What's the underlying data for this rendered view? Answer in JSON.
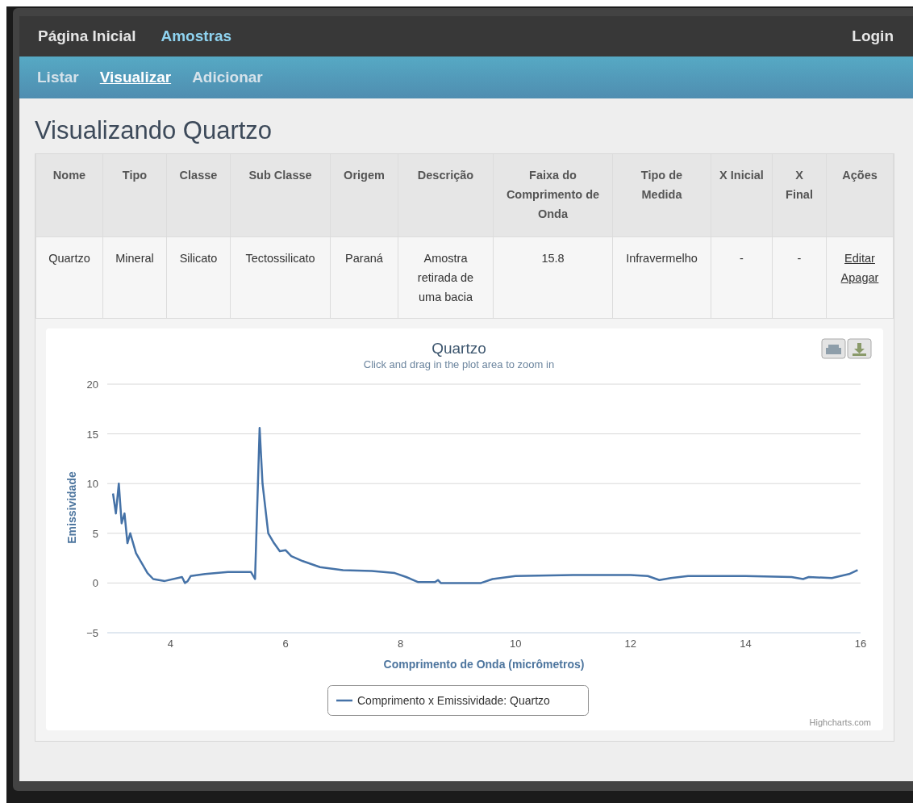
{
  "nav": {
    "items": [
      {
        "label": "Página Inicial",
        "selected": false
      },
      {
        "label": "Amostras",
        "selected": true
      }
    ],
    "login": "Login"
  },
  "subnav": {
    "items": [
      {
        "label": "Listar",
        "selected": false
      },
      {
        "label": "Visualizar",
        "selected": true
      },
      {
        "label": "Adicionar",
        "selected": false
      }
    ]
  },
  "page_title": "Visualizando Quartzo",
  "table": {
    "columns": [
      "Nome",
      "Tipo",
      "Classe",
      "Sub Classe",
      "Origem",
      "Descrição",
      "Faixa do Comprimento de Onda",
      "Tipo de Medida",
      "X Inicial",
      "X Final",
      "Ações"
    ],
    "rows": [
      {
        "cells": [
          "Quartzo",
          "Mineral",
          "Silicato",
          "Tectossilicato",
          "Paraná",
          "Amostra retirada de uma bacia",
          "15.8",
          "Infravermelho",
          "-",
          "-"
        ],
        "actions": [
          "Editar",
          "Apagar"
        ]
      }
    ]
  },
  "chart": {
    "title": "Quartzo",
    "subtitle": "Click and drag in the plot area to zoom in",
    "credits": "Highcharts.com",
    "chart_data": {
      "type": "line",
      "grid": true,
      "xlabel": "Comprimento de Onda (micrômetros)",
      "ylabel": "Emissividade",
      "xlim": [
        2.9,
        16
      ],
      "ylim": [
        -5,
        20
      ],
      "xticks": [
        4,
        6,
        8,
        10,
        12,
        14,
        16
      ],
      "yticks": [
        -5,
        0,
        5,
        10,
        15,
        20
      ],
      "x": [
        3.0,
        3.05,
        3.1,
        3.15,
        3.2,
        3.25,
        3.3,
        3.4,
        3.5,
        3.6,
        3.7,
        3.9,
        4.2,
        4.25,
        4.3,
        4.35,
        4.6,
        5.0,
        5.4,
        5.47,
        5.55,
        5.6,
        5.7,
        5.8,
        5.9,
        6.0,
        6.1,
        6.3,
        6.6,
        7.0,
        7.5,
        7.9,
        8.1,
        8.3,
        8.6,
        8.65,
        8.7,
        9.4,
        9.6,
        10,
        11,
        12,
        12.3,
        12.5,
        12.7,
        13,
        14,
        14.8,
        15.0,
        15.1,
        15.5,
        15.8,
        15.95
      ],
      "series": [
        {
          "name": "Comprimento x Emissividade: Quartzo",
          "color": "#4572a7",
          "values": [
            9,
            7,
            10,
            6,
            7,
            4,
            5,
            3,
            2,
            1,
            0.4,
            0.2,
            0.6,
            0,
            0.2,
            0.7,
            0.9,
            1.1,
            1.1,
            0.4,
            15.6,
            10,
            5,
            4,
            3.2,
            3.3,
            2.7,
            2.2,
            1.6,
            1.3,
            1.2,
            1.0,
            0.6,
            0.1,
            0.1,
            0.3,
            0,
            0,
            0.4,
            0.7,
            0.8,
            0.8,
            0.7,
            0.3,
            0.5,
            0.7,
            0.7,
            0.6,
            0.4,
            0.6,
            0.5,
            0.9,
            1.3
          ]
        }
      ]
    }
  }
}
